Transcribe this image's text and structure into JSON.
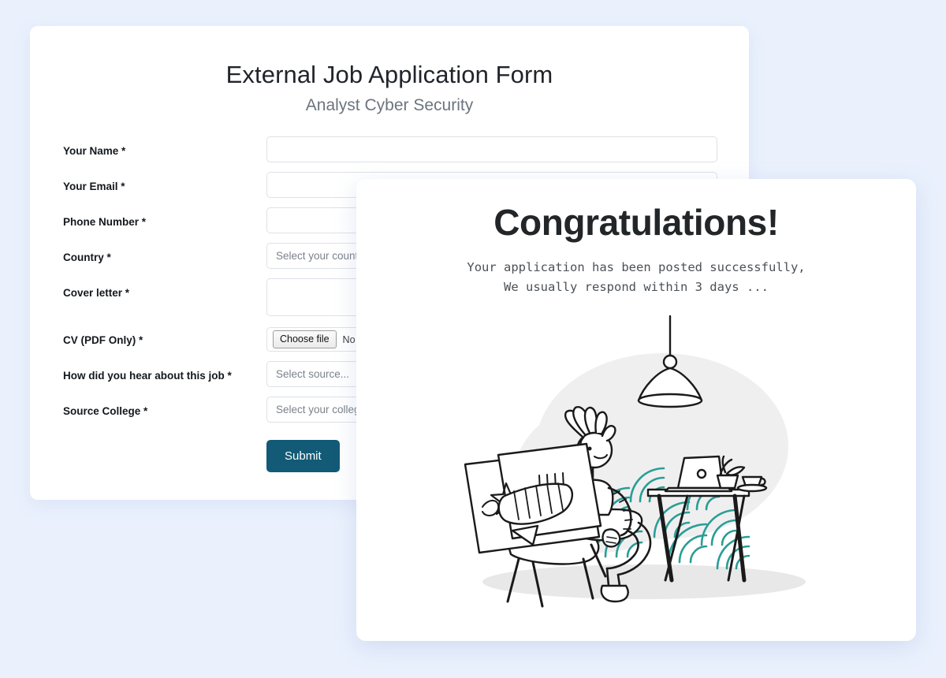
{
  "background_color": "#eaf1fd",
  "form": {
    "title": "External Job Application Form",
    "subtitle": "Analyst Cyber Security",
    "fields": [
      {
        "label": "Your Name *",
        "type": "text",
        "value": "",
        "placeholder": ""
      },
      {
        "label": "Your Email *",
        "type": "text",
        "value": "",
        "placeholder": ""
      },
      {
        "label": "Phone Number *",
        "type": "text",
        "value": "",
        "placeholder": ""
      },
      {
        "label": "Country *",
        "type": "select",
        "value": "Select your country",
        "placeholder": "Select your country"
      },
      {
        "label": "Cover letter *",
        "type": "textarea",
        "value": "",
        "placeholder": ""
      },
      {
        "label": "CV (PDF Only) *",
        "type": "file",
        "value": "",
        "placeholder": ""
      },
      {
        "label": "How did you hear about this job *",
        "type": "select",
        "value": "Select source...",
        "placeholder": "Select source..."
      },
      {
        "label": "Source College *",
        "type": "select",
        "value": "Select your college",
        "placeholder": "Select your college"
      }
    ],
    "file_input": {
      "button_label": "Choose file",
      "no_file_text": "No file chosen"
    },
    "submit_label": "Submit",
    "submit_color": "#125a75",
    "input_border_color": "#dde1e6"
  },
  "success": {
    "title": "Congratulations!",
    "message": "Your application has been posted successfully,\nWe usually respond within 3 days ...",
    "illustration": {
      "name": "person-reading-newspaper-at-desk",
      "line_color": "#1a1a1a",
      "accent_color": "#2a9d96",
      "blob_color": "#efefef"
    }
  }
}
